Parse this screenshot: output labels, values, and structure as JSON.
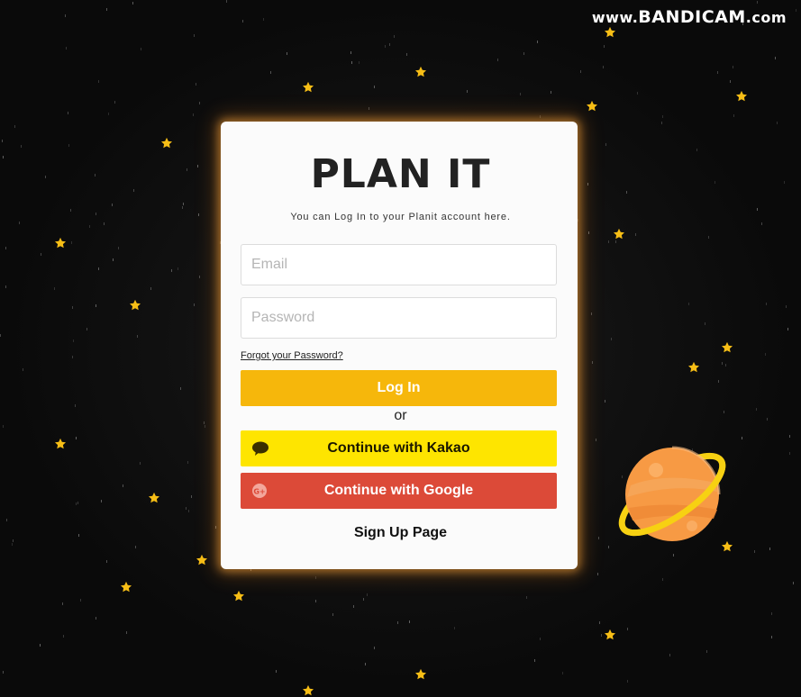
{
  "watermark": {
    "prefix": "www.",
    "brand": "BANDICAM",
    "suffix": ".com"
  },
  "login": {
    "title": "PLAN IT",
    "subtitle": "You can Log In to your Planit account here.",
    "email_placeholder": "Email",
    "password_placeholder": "Password",
    "forgot_label": "Forgot your Password?",
    "login_label": "Log In",
    "or_label": "or",
    "kakao_label": "Continue with Kakao",
    "google_label": "Continue with Google",
    "signup_label": "Sign Up Page"
  },
  "icons": {
    "kakao": "speech-bubble-icon",
    "google": "google-plus-icon",
    "stars": "star-icon",
    "planet": "planet-icon"
  },
  "colors": {
    "background": "#0a0a0a",
    "card": "#fbfbfb",
    "card_glow": "#ffaa3c",
    "login_button": "#f6b70b",
    "kakao_button": "#fee500",
    "google_button": "#dc4a38",
    "star": "#f7be16",
    "planet": "#f79a44",
    "planet_ring": "#f7d112"
  }
}
